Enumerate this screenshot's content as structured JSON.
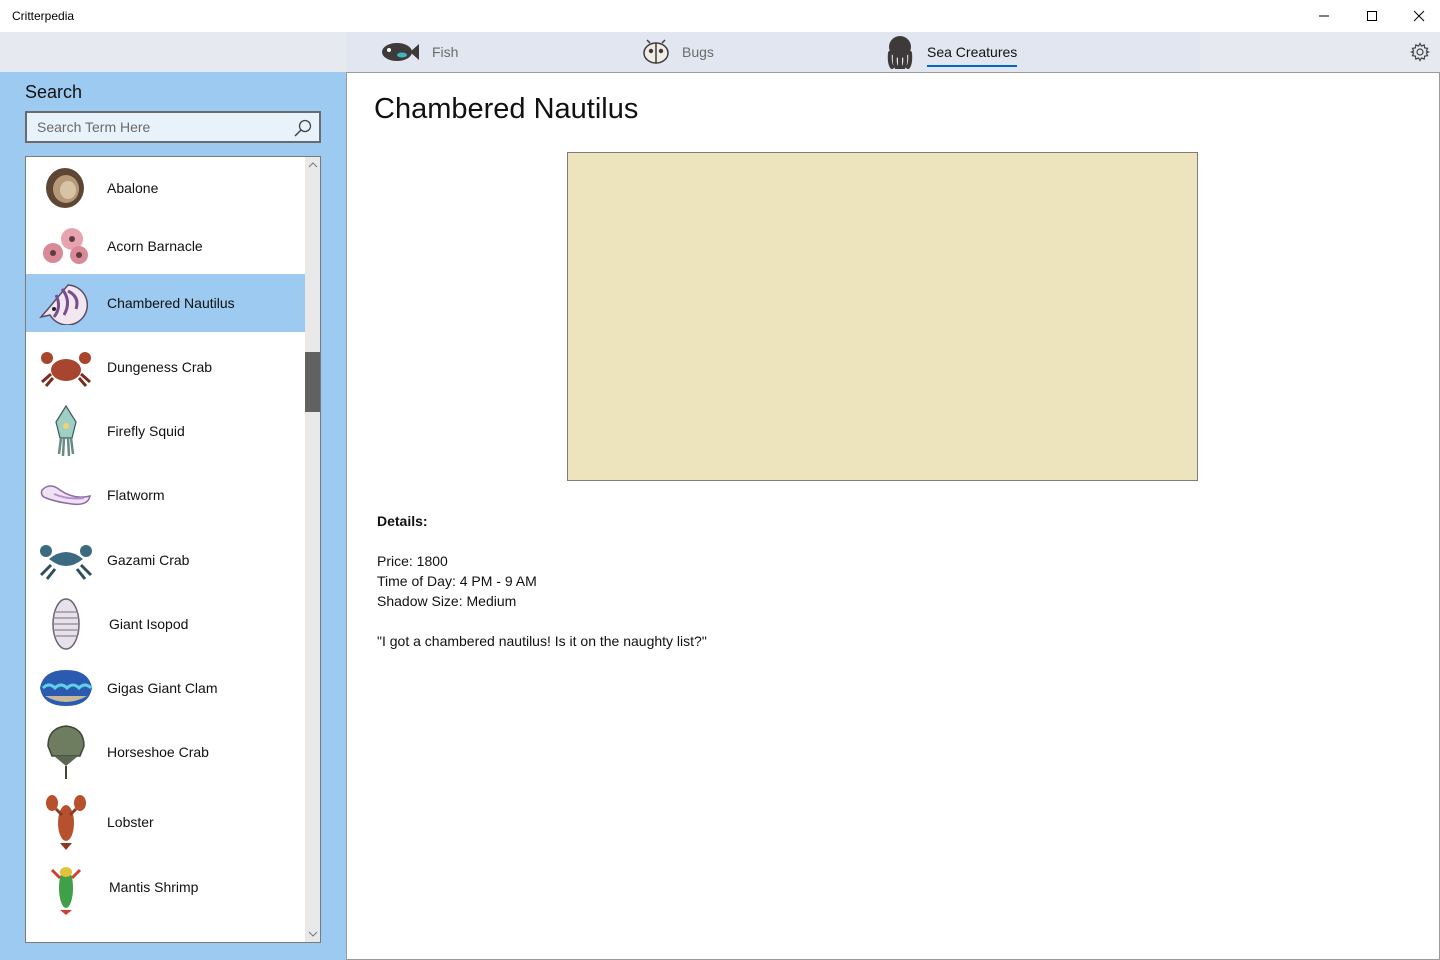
{
  "window": {
    "title": "Critterpedia",
    "controls": [
      "minimize-icon",
      "maximize-icon",
      "close-icon"
    ]
  },
  "nav": {
    "tabs": [
      {
        "label": "Fish",
        "icon": "fish-icon",
        "active": false
      },
      {
        "label": "Bugs",
        "icon": "bug-icon",
        "active": false
      },
      {
        "label": "Sea Creatures",
        "icon": "octopus-icon",
        "active": true
      }
    ],
    "settings_icon": "gear-icon"
  },
  "sidebar": {
    "heading": "Search",
    "search": {
      "placeholder": "Search Term Here",
      "value": "",
      "icon": "search-icon"
    },
    "items": [
      {
        "label": "Abalone",
        "icon": "abalone-icon"
      },
      {
        "label": "Acorn Barnacle",
        "icon": "acorn-barnacle-icon"
      },
      {
        "label": "Chambered Nautilus",
        "icon": "chambered-nautilus-icon",
        "selected": true
      },
      {
        "label": "Dungeness Crab",
        "icon": "dungeness-crab-icon"
      },
      {
        "label": "Firefly Squid",
        "icon": "firefly-squid-icon"
      },
      {
        "label": "Flatworm",
        "icon": "flatworm-icon"
      },
      {
        "label": "Gazami Crab",
        "icon": "gazami-crab-icon"
      },
      {
        "label": "Giant Isopod",
        "icon": "giant-isopod-icon"
      },
      {
        "label": "Gigas Giant Clam",
        "icon": "gigas-giant-clam-icon"
      },
      {
        "label": "Horseshoe Crab",
        "icon": "horseshoe-crab-icon"
      },
      {
        "label": "Lobster",
        "icon": "lobster-icon"
      },
      {
        "label": "Mantis Shrimp",
        "icon": "mantis-shrimp-icon"
      }
    ]
  },
  "main": {
    "title": "Chambered Nautilus",
    "image_placeholder_color": "#ede4bd",
    "details_heading": "Details:",
    "price": "Price: 1800",
    "time_of_day": "Time of Day: 4 PM - 9 AM",
    "shadow_size": "Shadow Size: Medium",
    "quote": "\"I got a chambered nautilus! Is it on the naughty list?\""
  },
  "colors": {
    "sidebar_bg": "#9ccaf0",
    "selected_item": "#9ccaf0",
    "accent": "#0067c0",
    "nav_bg": "#e6eaf0"
  }
}
